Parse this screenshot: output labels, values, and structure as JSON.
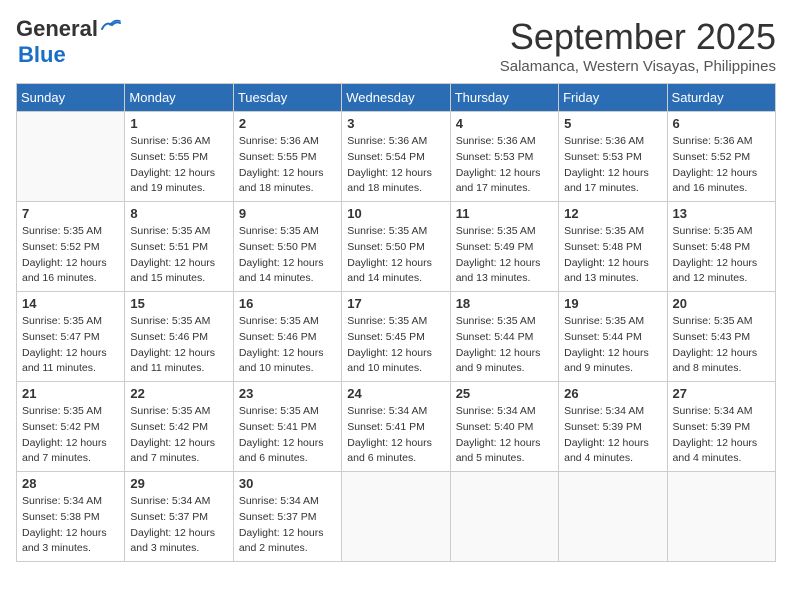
{
  "logo": {
    "line1": "General",
    "line2": "Blue"
  },
  "header": {
    "month": "September 2025",
    "subtitle": "Salamanca, Western Visayas, Philippines"
  },
  "weekdays": [
    "Sunday",
    "Monday",
    "Tuesday",
    "Wednesday",
    "Thursday",
    "Friday",
    "Saturday"
  ],
  "weeks": [
    [
      {
        "day": "",
        "info": ""
      },
      {
        "day": "1",
        "info": "Sunrise: 5:36 AM\nSunset: 5:55 PM\nDaylight: 12 hours\nand 19 minutes."
      },
      {
        "day": "2",
        "info": "Sunrise: 5:36 AM\nSunset: 5:55 PM\nDaylight: 12 hours\nand 18 minutes."
      },
      {
        "day": "3",
        "info": "Sunrise: 5:36 AM\nSunset: 5:54 PM\nDaylight: 12 hours\nand 18 minutes."
      },
      {
        "day": "4",
        "info": "Sunrise: 5:36 AM\nSunset: 5:53 PM\nDaylight: 12 hours\nand 17 minutes."
      },
      {
        "day": "5",
        "info": "Sunrise: 5:36 AM\nSunset: 5:53 PM\nDaylight: 12 hours\nand 17 minutes."
      },
      {
        "day": "6",
        "info": "Sunrise: 5:36 AM\nSunset: 5:52 PM\nDaylight: 12 hours\nand 16 minutes."
      }
    ],
    [
      {
        "day": "7",
        "info": "Sunrise: 5:35 AM\nSunset: 5:52 PM\nDaylight: 12 hours\nand 16 minutes."
      },
      {
        "day": "8",
        "info": "Sunrise: 5:35 AM\nSunset: 5:51 PM\nDaylight: 12 hours\nand 15 minutes."
      },
      {
        "day": "9",
        "info": "Sunrise: 5:35 AM\nSunset: 5:50 PM\nDaylight: 12 hours\nand 14 minutes."
      },
      {
        "day": "10",
        "info": "Sunrise: 5:35 AM\nSunset: 5:50 PM\nDaylight: 12 hours\nand 14 minutes."
      },
      {
        "day": "11",
        "info": "Sunrise: 5:35 AM\nSunset: 5:49 PM\nDaylight: 12 hours\nand 13 minutes."
      },
      {
        "day": "12",
        "info": "Sunrise: 5:35 AM\nSunset: 5:48 PM\nDaylight: 12 hours\nand 13 minutes."
      },
      {
        "day": "13",
        "info": "Sunrise: 5:35 AM\nSunset: 5:48 PM\nDaylight: 12 hours\nand 12 minutes."
      }
    ],
    [
      {
        "day": "14",
        "info": "Sunrise: 5:35 AM\nSunset: 5:47 PM\nDaylight: 12 hours\nand 11 minutes."
      },
      {
        "day": "15",
        "info": "Sunrise: 5:35 AM\nSunset: 5:46 PM\nDaylight: 12 hours\nand 11 minutes."
      },
      {
        "day": "16",
        "info": "Sunrise: 5:35 AM\nSunset: 5:46 PM\nDaylight: 12 hours\nand 10 minutes."
      },
      {
        "day": "17",
        "info": "Sunrise: 5:35 AM\nSunset: 5:45 PM\nDaylight: 12 hours\nand 10 minutes."
      },
      {
        "day": "18",
        "info": "Sunrise: 5:35 AM\nSunset: 5:44 PM\nDaylight: 12 hours\nand 9 minutes."
      },
      {
        "day": "19",
        "info": "Sunrise: 5:35 AM\nSunset: 5:44 PM\nDaylight: 12 hours\nand 9 minutes."
      },
      {
        "day": "20",
        "info": "Sunrise: 5:35 AM\nSunset: 5:43 PM\nDaylight: 12 hours\nand 8 minutes."
      }
    ],
    [
      {
        "day": "21",
        "info": "Sunrise: 5:35 AM\nSunset: 5:42 PM\nDaylight: 12 hours\nand 7 minutes."
      },
      {
        "day": "22",
        "info": "Sunrise: 5:35 AM\nSunset: 5:42 PM\nDaylight: 12 hours\nand 7 minutes."
      },
      {
        "day": "23",
        "info": "Sunrise: 5:35 AM\nSunset: 5:41 PM\nDaylight: 12 hours\nand 6 minutes."
      },
      {
        "day": "24",
        "info": "Sunrise: 5:34 AM\nSunset: 5:41 PM\nDaylight: 12 hours\nand 6 minutes."
      },
      {
        "day": "25",
        "info": "Sunrise: 5:34 AM\nSunset: 5:40 PM\nDaylight: 12 hours\nand 5 minutes."
      },
      {
        "day": "26",
        "info": "Sunrise: 5:34 AM\nSunset: 5:39 PM\nDaylight: 12 hours\nand 4 minutes."
      },
      {
        "day": "27",
        "info": "Sunrise: 5:34 AM\nSunset: 5:39 PM\nDaylight: 12 hours\nand 4 minutes."
      }
    ],
    [
      {
        "day": "28",
        "info": "Sunrise: 5:34 AM\nSunset: 5:38 PM\nDaylight: 12 hours\nand 3 minutes."
      },
      {
        "day": "29",
        "info": "Sunrise: 5:34 AM\nSunset: 5:37 PM\nDaylight: 12 hours\nand 3 minutes."
      },
      {
        "day": "30",
        "info": "Sunrise: 5:34 AM\nSunset: 5:37 PM\nDaylight: 12 hours\nand 2 minutes."
      },
      {
        "day": "",
        "info": ""
      },
      {
        "day": "",
        "info": ""
      },
      {
        "day": "",
        "info": ""
      },
      {
        "day": "",
        "info": ""
      }
    ]
  ]
}
